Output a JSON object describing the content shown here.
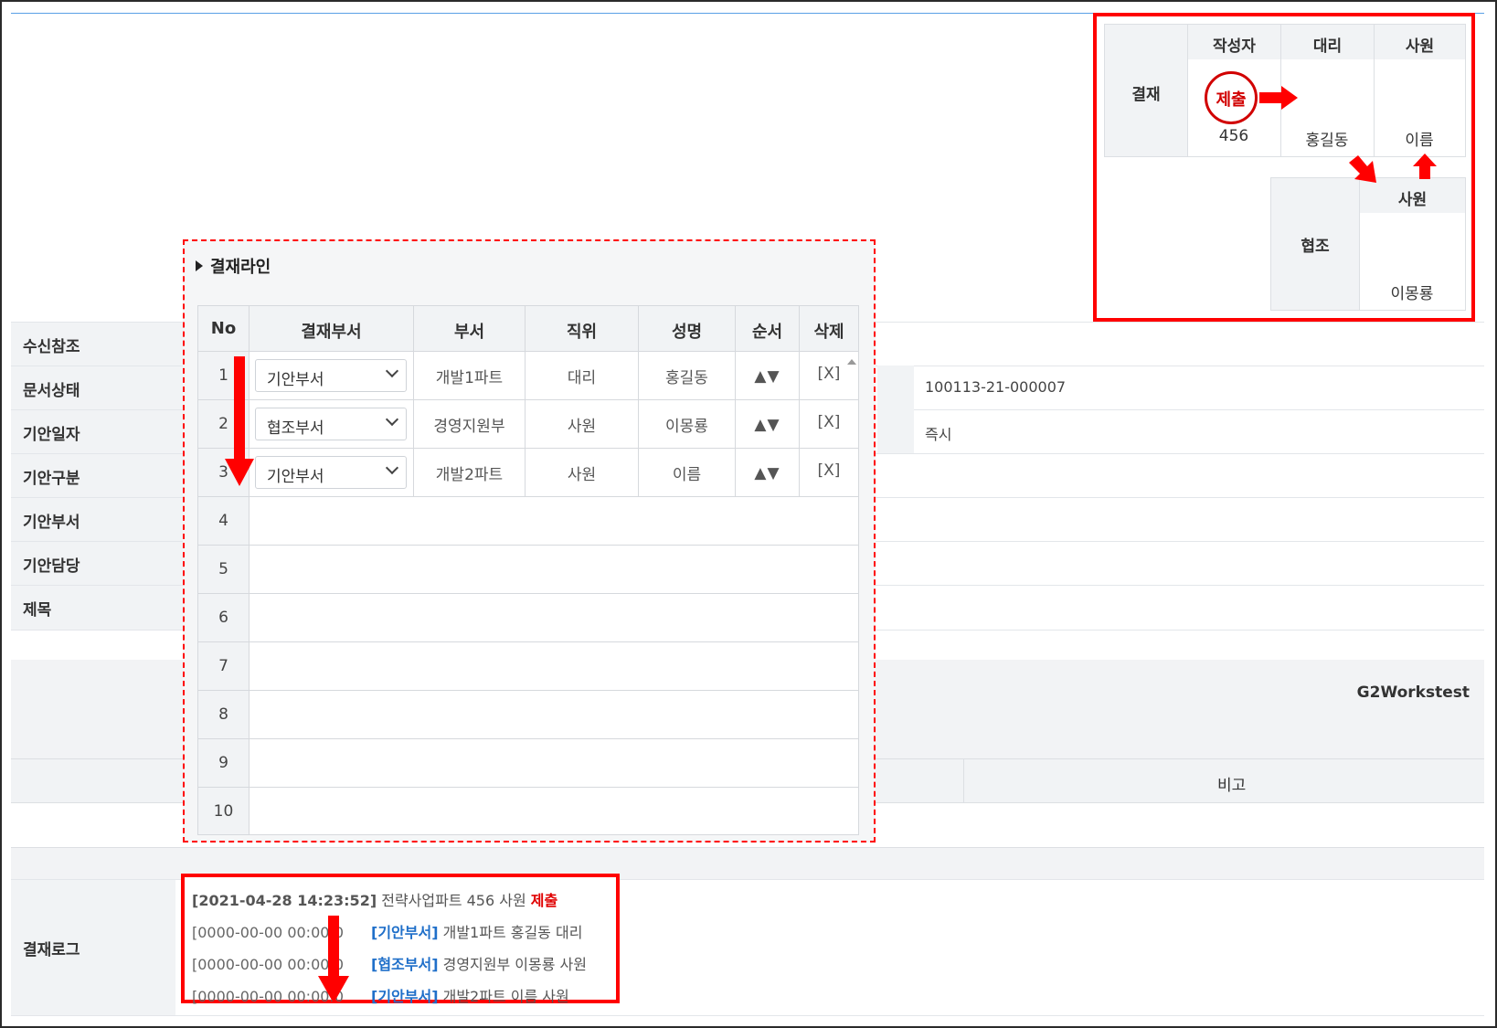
{
  "form": {
    "rows": [
      {
        "label": "수신참조"
      },
      {
        "label": "문서상태"
      },
      {
        "label": "기안일자"
      },
      {
        "label": "기안구분"
      },
      {
        "label": "기안부서"
      },
      {
        "label": "기안담당"
      },
      {
        "label": "제목"
      }
    ],
    "doc_number": "100113-21-000007",
    "timing": "즉시",
    "company": "G2Workstest",
    "note_header": "비고",
    "log_label": "결재로그"
  },
  "approval": {
    "label": "결재",
    "columns": [
      "작성자",
      "대리",
      "사원"
    ],
    "writer_stamp": "제출",
    "writer_name": "456",
    "names": [
      "홍길동",
      "이름"
    ],
    "coop_label": "협조",
    "coop_column": "사원",
    "coop_name": "이몽룡"
  },
  "popup": {
    "title": "결재라인",
    "headers": [
      "No",
      "결재부서",
      "부서",
      "직위",
      "성명",
      "순서",
      "삭제"
    ],
    "rows": [
      {
        "no": "1",
        "type": "기안부서",
        "dept": "개발1파트",
        "position": "대리",
        "name": "홍길동",
        "order": "▲▼",
        "delete": "[X]"
      },
      {
        "no": "2",
        "type": "협조부서",
        "dept": "경영지원부",
        "position": "사원",
        "name": "이몽룡",
        "order": "▲▼",
        "delete": "[X]"
      },
      {
        "no": "3",
        "type": "기안부서",
        "dept": "개발2파트",
        "position": "사원",
        "name": "이름",
        "order": "▲▼",
        "delete": "[X]"
      }
    ],
    "empty_rows": [
      "4",
      "5",
      "6",
      "7",
      "8",
      "9",
      "10"
    ]
  },
  "log": {
    "lines": [
      {
        "ts": "[2021-04-28 14:23:52]",
        "text": " 전략사업파트 456 사원 ",
        "status": "제출"
      },
      {
        "ts": "[0000-00-00 00:00:0",
        "dept": "[기안부서]",
        "text": " 개발1파트 홍길동 대리"
      },
      {
        "ts": "[0000-00-00 00:00:0",
        "dept": "[협조부서]",
        "text": " 경영지원부 이몽룡 사원"
      },
      {
        "ts": "[0000-00-00 00:00:0",
        "dept": "[기안부서]",
        "text": " 개발2파트 이름 사원"
      }
    ]
  },
  "colors": {
    "highlight": "#ff0000",
    "link": "#1f6fc9",
    "header_bg": "#f1f3f5"
  }
}
